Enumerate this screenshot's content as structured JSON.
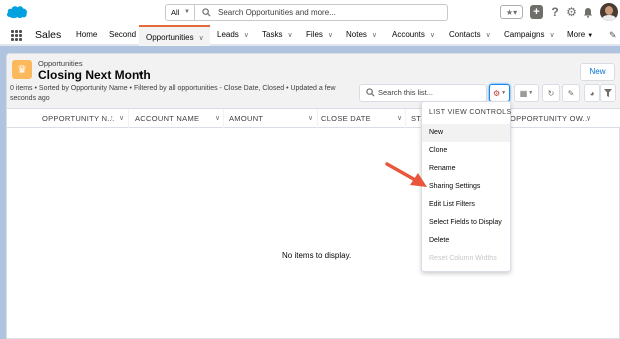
{
  "colors": {
    "brand": "#00a1e0",
    "nav_accent": "#e26a38",
    "link": "#0070d2",
    "object_icon": "#fcb95b",
    "annotation_arrow": "#e8563c"
  },
  "global_header": {
    "search_scope": "All",
    "search_placeholder": "Search Opportunities and more...",
    "icons": [
      "salesforce-cloud-icon",
      "search-icon",
      "star-icon",
      "plus-icon",
      "help-icon",
      "gear-icon",
      "bell-icon",
      "avatar"
    ]
  },
  "nav": {
    "app_name": "Sales",
    "items": [
      "Home",
      "Second",
      "Opportunities",
      "Leads",
      "Tasks",
      "Files",
      "Notes",
      "Accounts",
      "Contacts",
      "Campaigns",
      "More"
    ],
    "active": "Opportunities"
  },
  "list_header": {
    "object_label": "Opportunities",
    "list_view_name": "Closing Next Month",
    "meta": "0 items • Sorted by Opportunity Name • Filtered by all opportunities - Close Date, Closed • Updated a few seconds ago",
    "new_button": "New",
    "search_placeholder": "Search this list..."
  },
  "table": {
    "columns": [
      "OPPORTUNITY N...",
      "ACCOUNT NAME",
      "AMOUNT",
      "CLOSE DATE",
      "STA",
      "OPPORTUNITY OW..."
    ],
    "sort_indicator": "↑",
    "empty_message": "No items to display."
  },
  "menu": {
    "heading": "LIST VIEW CONTROLS",
    "items": [
      "New",
      "Clone",
      "Rename",
      "Sharing Settings",
      "Edit List Filters",
      "Select Fields to Display",
      "Delete",
      "Reset Column Widths"
    ],
    "highlighted": "New",
    "disabled": "Reset Column Widths",
    "pointed_at": "Sharing Settings"
  }
}
